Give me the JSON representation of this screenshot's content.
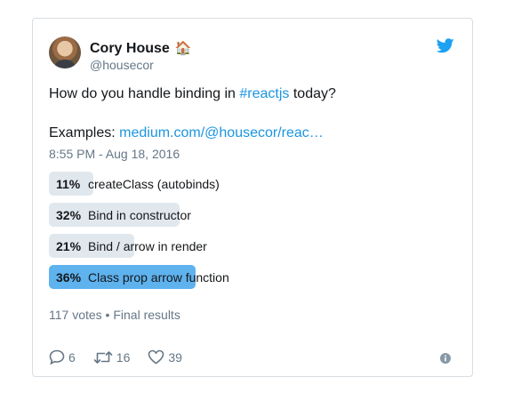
{
  "tweet": {
    "author_name": "Cory House",
    "author_emoji": "🏠",
    "author_handle": "@housecor",
    "text_prefix": "How do you handle binding in ",
    "hashtag": "#reactjs",
    "text_suffix": " today?",
    "examples_label": "Examples: ",
    "examples_link": "medium.com/@housecor/reac…",
    "timestamp": "8:55 PM - Aug 18, 2016"
  },
  "poll": {
    "options": [
      {
        "percent": "11%",
        "label": "createClass (autobinds)",
        "value": 11,
        "winner": false
      },
      {
        "percent": "32%",
        "label": "Bind in constructor",
        "value": 32,
        "winner": false
      },
      {
        "percent": "21%",
        "label": "Bind / arrow in render",
        "value": 21,
        "winner": false
      },
      {
        "percent": "36%",
        "label": "Class prop arrow function",
        "value": 36,
        "winner": true
      }
    ],
    "summary": "117 votes • Final results"
  },
  "actions": {
    "reply_count": "6",
    "retweet_count": "16",
    "like_count": "39"
  },
  "icons": [
    "twitter-bird-icon",
    "reply-icon",
    "retweet-icon",
    "heart-icon",
    "info-icon"
  ],
  "colors": {
    "accent": "#1b95e0",
    "bird": "#1da1f2",
    "winner_bar": "#5eb2ee",
    "bar": "#e1e8ed",
    "muted": "#657786"
  }
}
